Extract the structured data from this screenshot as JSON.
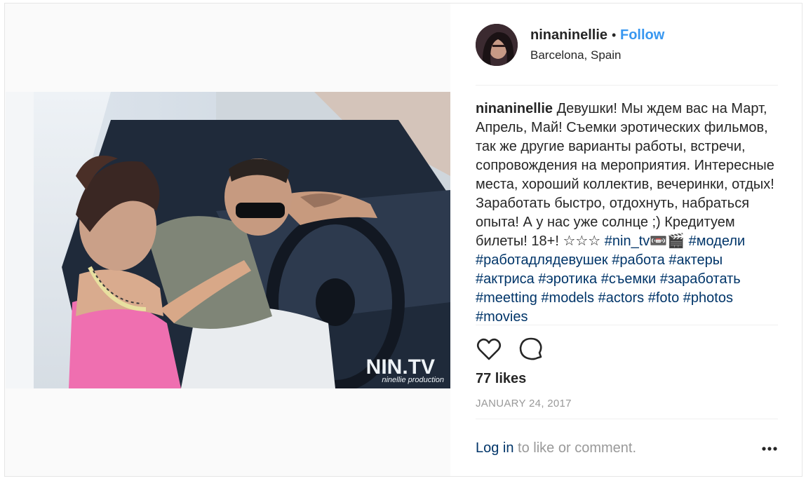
{
  "post": {
    "username": "ninaninellie",
    "separator_dot": "•",
    "follow_label": "Follow",
    "location": "Barcelona, Spain",
    "caption": {
      "username": "ninaninellie",
      "text": "Девушки! Мы ждем вас на Март, Апрель, Май! Съемки эротических фильмов, так же другие варианты работы, встречи, сопровождения на мероприятия. Интересные места, хороший коллектив, вечеринки, отдых! Заработать быстро, отдохнуть, набраться опыта! А у нас уже солнце ;) Кредитуем билеты! 18+! ☆☆☆",
      "hashtags": [
        "#nin_tv📼🎬",
        "#модели",
        "#работадлядевушек",
        "#работа",
        "#актеры",
        "#актриса",
        "#эротика",
        "#съемки",
        "#заработать",
        "#meetting",
        "#models",
        "#actors",
        "#foto",
        "#photos",
        "#movies"
      ]
    },
    "likes": "77 likes",
    "date": "JANUARY 24, 2017",
    "login_link": "Log in",
    "login_rest": " to like or comment.",
    "image_watermark": {
      "title": "NIN.TV",
      "subtitle": "ninellie production"
    },
    "icons": {
      "like": "heart-icon",
      "comment": "comment-icon",
      "more": "more-options-icon",
      "avatar": "avatar"
    }
  }
}
